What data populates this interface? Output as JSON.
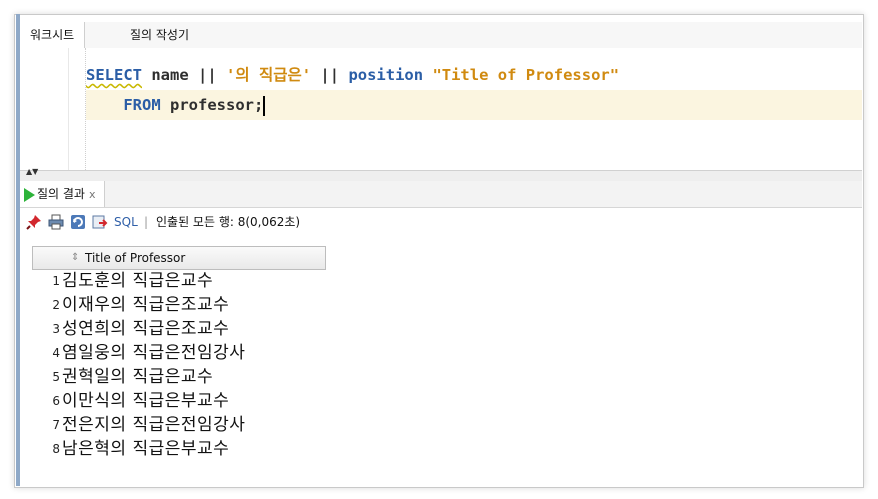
{
  "worksheet": {
    "tabs": [
      {
        "label": "워크시트"
      },
      {
        "label": "질의 작성기"
      }
    ]
  },
  "editor": {
    "line1": {
      "kw_select": "SELECT",
      "col_name": "name",
      "op1": "||",
      "str1": "'의 직급은'",
      "op2": "||",
      "col_position": "position",
      "alias": "\"Title of Professor\""
    },
    "line2": {
      "kw_from": "FROM",
      "table": "professor;"
    }
  },
  "results": {
    "tab_label": "질의 결과",
    "close_label": "x",
    "toolbar": {
      "sql_label": "SQL",
      "separator": "|",
      "status": "인출된 모든 행: 8(0,062초)"
    },
    "column_header": "Title of Professor",
    "rows": [
      {
        "num": "1",
        "text": "김도훈의 직급은교수"
      },
      {
        "num": "2",
        "text": "이재우의 직급은조교수"
      },
      {
        "num": "3",
        "text": "성연희의 직급은조교수"
      },
      {
        "num": "4",
        "text": "염일웅의 직급은전임강사"
      },
      {
        "num": "5",
        "text": "권혁일의 직급은교수"
      },
      {
        "num": "6",
        "text": "이만식의 직급은부교수"
      },
      {
        "num": "7",
        "text": "전은지의 직급은전임강사"
      },
      {
        "num": "8",
        "text": "남은혁의 직급은부교수"
      }
    ]
  },
  "colors": {
    "keyword": "#2b5ea6",
    "string": "#d08a10",
    "run_icon": "#2db33a",
    "current_line": "#fbf5e0"
  },
  "icons": {
    "run": "play-icon",
    "pin": "pin-icon",
    "print": "print-icon",
    "refresh": "refresh-icon",
    "export": "export-icon",
    "sort": "sort-icon"
  }
}
